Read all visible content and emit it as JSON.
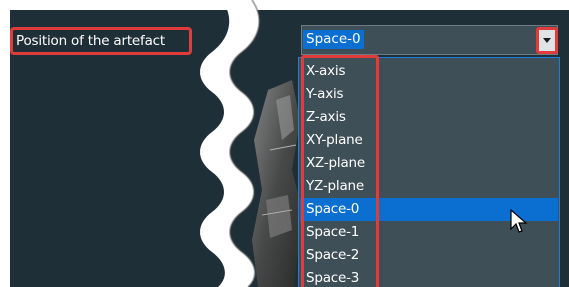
{
  "label": {
    "text": "Position of the artefact"
  },
  "select": {
    "value": "Space-0"
  },
  "dropdown": {
    "options": [
      "X-axis",
      "Y-axis",
      "Z-axis",
      "XY-plane",
      "XZ-plane",
      "YZ-plane",
      "Space-0",
      "Space-1",
      "Space-2",
      "Space-3"
    ],
    "selected_index": 6
  },
  "colors": {
    "panel_bg": "#1f2f38",
    "select_bg": "#3f4f57",
    "highlight_blue": "#0a6fd1",
    "annotation_red": "#e23b3b"
  },
  "icons": {
    "dropdown": "chevron-down-icon",
    "cursor": "mouse-pointer-icon"
  }
}
